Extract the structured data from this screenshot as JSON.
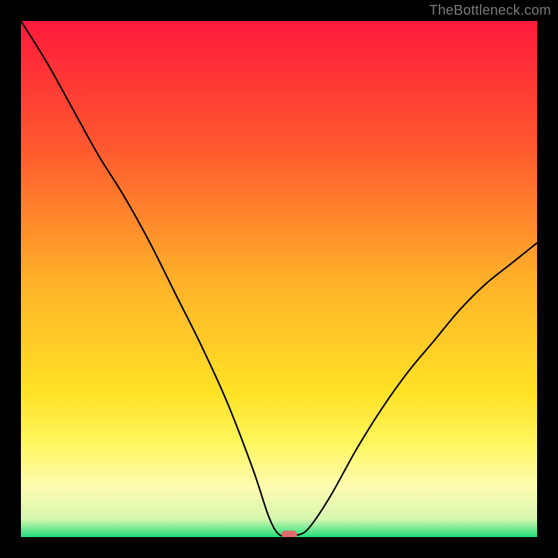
{
  "watermark": "TheBottleneck.com",
  "chart_data": {
    "type": "line",
    "title": "",
    "xlabel": "",
    "ylabel": "",
    "xlim": [
      0,
      100
    ],
    "ylim": [
      0,
      100
    ],
    "background_gradient": {
      "stops": [
        {
          "offset": 0.0,
          "color": "#ff1a3c"
        },
        {
          "offset": 0.25,
          "color": "#ff5a2e"
        },
        {
          "offset": 0.5,
          "color": "#ffb029"
        },
        {
          "offset": 0.72,
          "color": "#ffe225"
        },
        {
          "offset": 0.82,
          "color": "#fff760"
        },
        {
          "offset": 0.9,
          "color": "#fffcb0"
        },
        {
          "offset": 0.965,
          "color": "#d7f7b0"
        },
        {
          "offset": 1.0,
          "color": "#1fe07a"
        }
      ]
    },
    "series": [
      {
        "name": "bottleneck-curve",
        "x": [
          0,
          5,
          10,
          15,
          20,
          25,
          30,
          35,
          40,
          45,
          48,
          50,
          52,
          54,
          56,
          60,
          65,
          70,
          75,
          80,
          85,
          90,
          95,
          100
        ],
        "y": [
          100,
          92,
          83,
          74,
          66,
          57,
          47,
          37,
          26,
          13,
          4,
          0.5,
          0.5,
          0.5,
          2,
          8,
          17,
          25,
          32,
          38,
          44,
          49,
          53,
          57
        ]
      }
    ],
    "marker": {
      "x": 52,
      "y": 0.5,
      "color": "#e06a6a"
    }
  }
}
